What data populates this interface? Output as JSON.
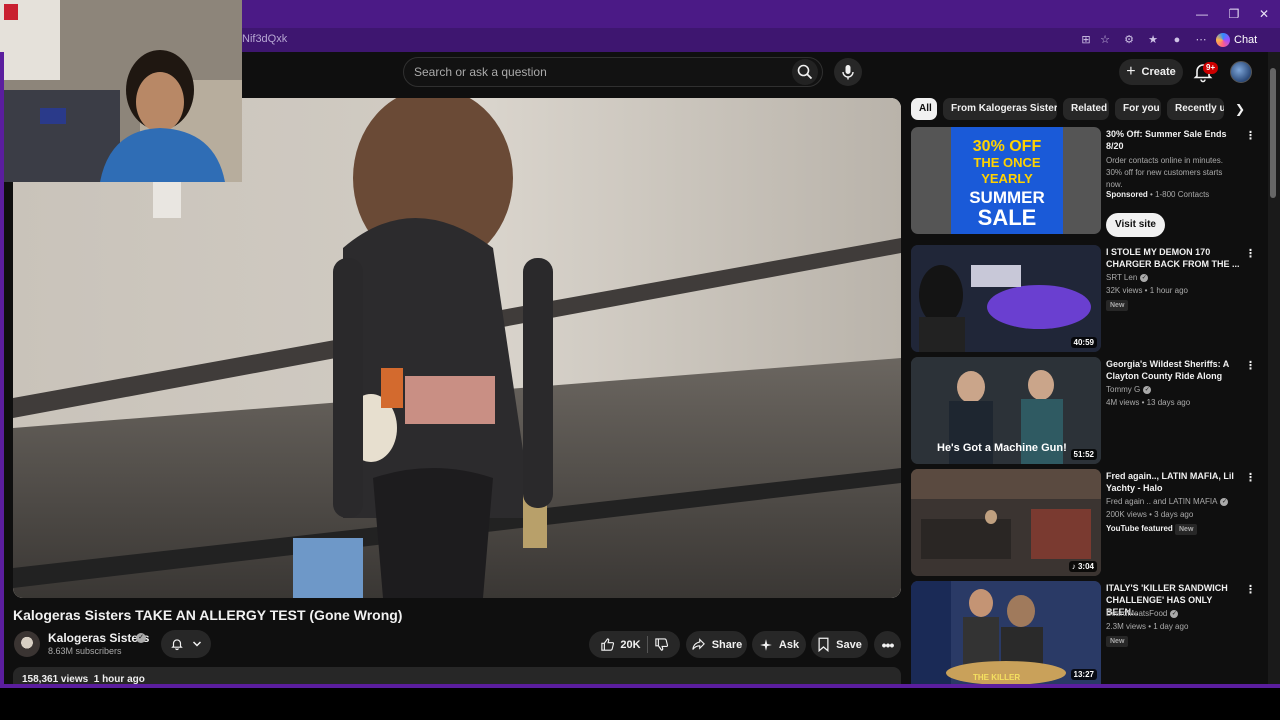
{
  "browser": {
    "address_fragment": "Nif3dQxk",
    "chat_label": "Chat",
    "window_controls": [
      "minimize-icon",
      "restore-icon",
      "close-icon"
    ]
  },
  "header": {
    "search_placeholder": "Search or ask a question",
    "create_label": "Create",
    "notification_count": "9+"
  },
  "video": {
    "title": "Kalogeras Sisters TAKE AN ALLERGY TEST (Gone Wrong)",
    "channel": "Kalogeras Sisters",
    "subscribers": "8.63M subscribers",
    "likes": "20K",
    "share_label": "Share",
    "ask_label": "Ask",
    "save_label": "Save",
    "views": "158,361 views",
    "uploaded": "1 hour ago"
  },
  "chips": [
    "All",
    "From Kalogeras Sisters",
    "Related",
    "For you",
    "Recently up"
  ],
  "ad": {
    "title": "30% Off: Summer Sale Ends 8/20",
    "description": "Order contacts online in minutes. 30% off for new customers starts now.",
    "sponsored": "Sponsored",
    "advertiser": "1-800 Contacts",
    "cta": "Visit site",
    "thumb_text": [
      "30% OFF",
      "THE ONCE",
      "YEARLY",
      "SUMMER",
      "SALE"
    ]
  },
  "recommendations": [
    {
      "title": "I STOLE MY DEMON 170 CHARGER BACK FROM THE ...",
      "channel": "SRT Len",
      "meta": "32K views • 1 hour ago",
      "badge": "New",
      "badge2": "",
      "duration": "40:59",
      "thumb_caption": ""
    },
    {
      "title": "Georgia's Wildest Sheriffs: A Clayton County Ride Along",
      "channel": "Tommy G",
      "meta": "4M views • 13 days ago",
      "badge": "",
      "badge2": "",
      "duration": "51:52",
      "thumb_caption": "He's Got a Machine Gun!"
    },
    {
      "title": "Fred again.., LATIN MAFIA, Lil Yachty - Halo",
      "channel": "Fred again .. and LATIN MAFIA",
      "meta": "200K views • 3 days ago",
      "badge": "New",
      "badge2": "YouTube featured",
      "duration": "3:04",
      "thumb_caption": ""
    },
    {
      "title": "ITALY'S 'KILLER SANDWICH CHALLENGE' HAS ONLY BEEN...",
      "channel": "BeardMeatsFood",
      "meta": "2.3M views • 1 day ago",
      "badge": "New",
      "badge2": "",
      "duration": "13:27",
      "thumb_caption": "THE KILLER"
    }
  ],
  "colors": {
    "browser_purple": "#4b1a86",
    "yt_background": "#0f0f0f",
    "chip_background": "#272727",
    "notification_red": "#cc0000"
  }
}
